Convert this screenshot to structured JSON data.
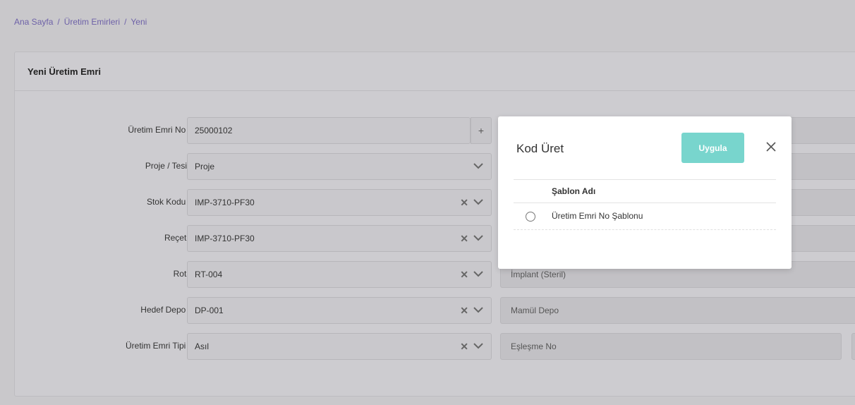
{
  "breadcrumb": {
    "items": [
      "Ana Sayfa",
      "Üretim Emirleri",
      "Yeni"
    ],
    "separator": "/"
  },
  "card": {
    "title": "Yeni Üretim Emri"
  },
  "form": {
    "production_order_no": {
      "label": "Üretim Emri No",
      "value": "25000102",
      "required": true,
      "add_label": "+"
    },
    "project": {
      "label": "Proje / Tesis",
      "value": "Proje"
    },
    "stock_code": {
      "label": "Stok Kodu",
      "value": "IMP-3710-PF30",
      "required": true
    },
    "recipe": {
      "label": "Reçete",
      "value": "IMP-3710-PF30"
    },
    "route": {
      "label": "Rota",
      "value": "RT-004",
      "description": "İmplant (Steril)"
    },
    "target_warehouse": {
      "label": "Hedef Depo",
      "value": "DP-001",
      "required": true,
      "description": "Mamül Depo"
    },
    "order_type": {
      "label": "Üretim Emri Tipi",
      "value": "Asıl",
      "required": true,
      "match_placeholder": "Eşleşme No"
    }
  },
  "modal": {
    "title": "Kod Üret",
    "apply_label": "Uygula",
    "column_header": "Şablon Adı",
    "rows": [
      "Üretim Emri No Şablonu"
    ]
  },
  "colors": {
    "accent": "#78d5cd",
    "required": "#d8354a",
    "breadcrumb": "#6e62a8"
  }
}
